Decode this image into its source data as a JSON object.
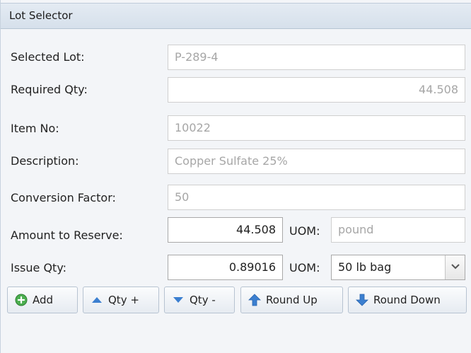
{
  "panel": {
    "title": "Lot Selector"
  },
  "form": {
    "selected_lot": {
      "label": "Selected Lot:",
      "value": "P-289-4"
    },
    "required_qty": {
      "label": "Required Qty:",
      "value": "44.508"
    },
    "item_no": {
      "label": "Item No:",
      "value": "10022"
    },
    "description": {
      "label": "Description:",
      "value": "Copper Sulfate 25%"
    },
    "conversion_factor": {
      "label": "Conversion Factor:",
      "value": "50"
    },
    "amount_to_reserve": {
      "label": "Amount to Reserve:",
      "value": "44.508",
      "uom_label": "UOM:",
      "uom_value": "pound"
    },
    "issue_qty": {
      "label": "Issue Qty:",
      "value": "0.89016",
      "uom_label": "UOM:",
      "uom_value": "50 lb bag"
    }
  },
  "toolbar": {
    "add": {
      "label": "Add",
      "icon": "add-circle-icon"
    },
    "qty_plus": {
      "label": "Qty +",
      "icon": "triangle-up-icon"
    },
    "qty_minus": {
      "label": "Qty -",
      "icon": "triangle-down-icon"
    },
    "round_up": {
      "label": "Round Up",
      "icon": "arrow-up-icon"
    },
    "round_down": {
      "label": "Round Down",
      "icon": "arrow-down-icon"
    }
  },
  "colors": {
    "accent_blue": "#3b7fd0",
    "add_green": "#4caf50",
    "header_bg": "#dbe4ee"
  }
}
